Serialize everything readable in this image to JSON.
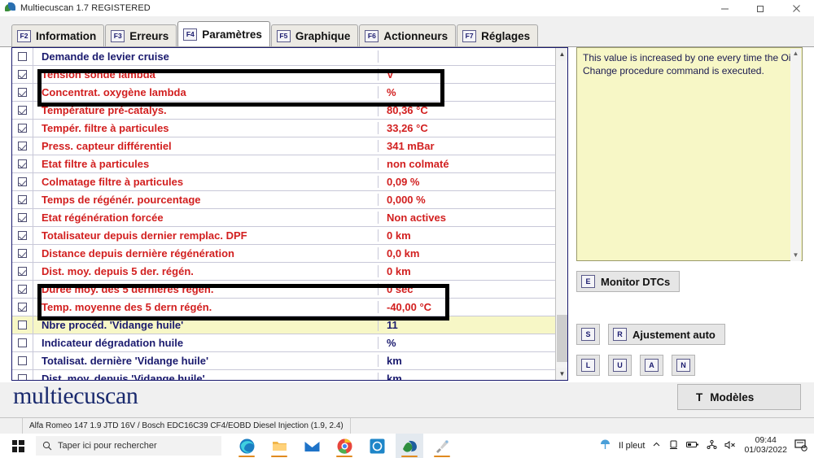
{
  "window": {
    "title": "Multiecuscan 1.7 REGISTERED",
    "icon": "multiecuscan-leaf-icon",
    "buttons": {
      "minimize": "minimize-icon",
      "maximize": "maximize-icon",
      "close": "close-icon"
    }
  },
  "tabs": [
    {
      "key": "F2",
      "label": "Information",
      "active": false
    },
    {
      "key": "F3",
      "label": "Erreurs",
      "active": false
    },
    {
      "key": "F4",
      "label": "Paramètres",
      "active": true
    },
    {
      "key": "F5",
      "label": "Graphique",
      "active": false
    },
    {
      "key": "F6",
      "label": "Actionneurs",
      "active": false
    },
    {
      "key": "F7",
      "label": "Réglages",
      "active": false
    }
  ],
  "parameters": {
    "rows": [
      {
        "checked": false,
        "name": "Demande de levier cruise",
        "value": "",
        "color": "blue",
        "selected": false
      },
      {
        "checked": true,
        "name": "Tension sonde lambda",
        "value": "V",
        "color": "red",
        "selected": false
      },
      {
        "checked": true,
        "name": "Concentrat. oxygène lambda",
        "value": "%",
        "color": "red",
        "selected": false
      },
      {
        "checked": true,
        "name": "Température pré-catalys.",
        "value": "80,36 °C",
        "color": "red",
        "selected": false
      },
      {
        "checked": true,
        "name": "Tempér. filtre à particules",
        "value": "33,26 °C",
        "color": "red",
        "selected": false
      },
      {
        "checked": true,
        "name": "Press. capteur différentiel",
        "value": "341 mBar",
        "color": "red",
        "selected": false
      },
      {
        "checked": true,
        "name": "Etat filtre à particules",
        "value": "non colmaté",
        "color": "red",
        "selected": false
      },
      {
        "checked": true,
        "name": "Colmatage filtre  à particules",
        "value": "0,09 %",
        "color": "red",
        "selected": false
      },
      {
        "checked": true,
        "name": "Temps de régénér. pourcentage",
        "value": "0,000 %",
        "color": "red",
        "selected": false
      },
      {
        "checked": true,
        "name": "Etat régénération forcée",
        "value": "Non actives",
        "color": "red",
        "selected": false
      },
      {
        "checked": true,
        "name": "Totalisateur depuis dernier remplac. DPF",
        "value": "0 km",
        "color": "red",
        "selected": false
      },
      {
        "checked": true,
        "name": "Distance depuis dernière régénération",
        "value": "0,0 km",
        "color": "red",
        "selected": false
      },
      {
        "checked": true,
        "name": "Dist. moy. depuis 5 der. régén.",
        "value": "0 km",
        "color": "red",
        "selected": false
      },
      {
        "checked": true,
        "name": "Durée moy. des 5 dernières régén.",
        "value": "0 sec",
        "color": "red",
        "selected": false
      },
      {
        "checked": true,
        "name": "Temp. moyenne des 5 dern régén.",
        "value": "-40,00 °C",
        "color": "red",
        "selected": false
      },
      {
        "checked": false,
        "name": "Nbre procéd. 'Vidange huile'",
        "value": "11",
        "color": "blue",
        "selected": true
      },
      {
        "checked": false,
        "name": "Indicateur dégradation huile",
        "value": "%",
        "color": "blue",
        "selected": false
      },
      {
        "checked": false,
        "name": "Totalisat. dernière 'Vidange huile'",
        "value": "km",
        "color": "blue",
        "selected": false
      },
      {
        "checked": false,
        "name": "Dist. moy. depuis 'Vidange huile'",
        "value": "km",
        "color": "blue",
        "selected": false
      }
    ]
  },
  "description": {
    "text": "This value is increased by one every time the Oil Change procedure command is executed."
  },
  "side_buttons": {
    "monitor_dtcs": {
      "key": "E",
      "label": "Monitor DTCs"
    },
    "s_button": {
      "key": "S",
      "label": ""
    },
    "auto_adjust": {
      "key": "R",
      "label": "Ajustement auto"
    },
    "small": [
      {
        "key": "L",
        "label": ""
      },
      {
        "key": "U",
        "label": ""
      },
      {
        "key": "A",
        "label": ""
      },
      {
        "key": "N",
        "label": ""
      }
    ]
  },
  "footer": {
    "logo": "multiecuscan",
    "models_button": {
      "key": "T",
      "label": "Modèles"
    },
    "status_text": "Alfa Romeo 147 1.9 JTD 16V / Bosch EDC16C39 CF4/EOBD Diesel Injection (1.9, 2.4)"
  },
  "taskbar": {
    "start": "windows-start-icon",
    "search_placeholder": "Taper ici pour rechercher",
    "apps": [
      {
        "name": "edge-icon",
        "active": false,
        "running": true
      },
      {
        "name": "file-explorer-icon",
        "active": false,
        "running": true
      },
      {
        "name": "mail-icon",
        "active": false,
        "running": false
      },
      {
        "name": "chrome-icon",
        "active": false,
        "running": true
      },
      {
        "name": "blue-app-icon",
        "active": false,
        "running": false
      },
      {
        "name": "multiecuscan-icon",
        "active": true,
        "running": true
      },
      {
        "name": "paint-app-icon",
        "active": false,
        "running": true
      }
    ],
    "weather": {
      "icon": "umbrella-rain-icon",
      "label": "Il pleut"
    },
    "tray_icons": [
      "chevron-up-icon",
      "onedrive-icon",
      "battery-icon",
      "network-icon",
      "volume-muted-icon"
    ],
    "clock": {
      "time": "09:44",
      "date": "01/03/2022"
    },
    "notification": "notification-icon"
  },
  "colors": {
    "red_param": "#d21f1f",
    "blue_param": "#1a1a6e",
    "selected_row": "#f7f7c6",
    "description_bg": "#f7f7c6",
    "annotation": "#000000"
  }
}
